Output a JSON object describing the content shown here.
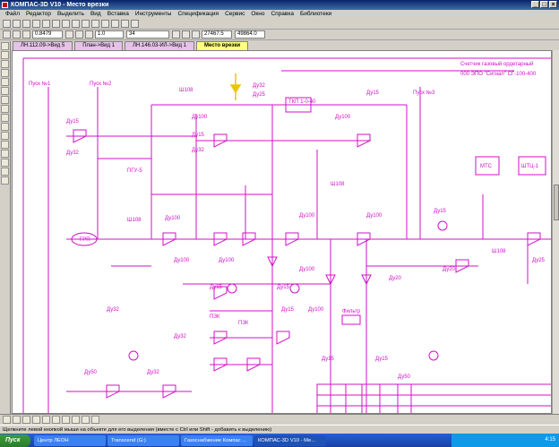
{
  "window": {
    "title": "КОМПАС-3D V10 - Место врезки"
  },
  "menu": [
    "Файл",
    "Редактор",
    "Выделить",
    "Вид",
    "Вставка",
    "Инструменты",
    "Спецификация",
    "Сервис",
    "Окно",
    "Справка",
    "Библиотеки"
  ],
  "toolbar": {
    "zoom": "0.8479",
    "line_width": "1.0",
    "layer": "34",
    "coord_x": "27467.5",
    "coord_y": "49864.0"
  },
  "tabs": [
    {
      "label": "ЛН.112.09->Вид 5",
      "active": false
    },
    {
      "label": "План->Вид 1",
      "active": false
    },
    {
      "label": "ЛН.146.03-ИЛ->Вид 1",
      "active": false
    },
    {
      "label": "Место врезки",
      "active": true
    }
  ],
  "drawing": {
    "stamp_line1": "Счетчик газовый ордетарный",
    "stamp_line2": "000 ЭПО \"Сигнал\" СГ-100-400",
    "labels": [
      "Пуск №1",
      "Пуск №2",
      "Ду15",
      "Ду32",
      "Ду100",
      "Ду15",
      "Ду32",
      "ПГУ-5",
      "Ш108",
      "Ду100",
      "Ду32",
      "Ду25",
      "Ду15",
      "Ду100",
      "Ду100",
      "Ду100",
      "МТС",
      "ШТЦ-1",
      "Ду15",
      "Ш108",
      "Ду100",
      "Ду100",
      "ГРП",
      "Ш108",
      "Ду15",
      "Ду15",
      "Ш108",
      "Ду20",
      "Ду100",
      "Ду50",
      "Ду32",
      "Ду15",
      "ПЗК",
      "ПЗК",
      "Ду100",
      "Фильтр",
      "Ду15",
      "Ду15",
      "Ду20",
      "Ду50",
      "Ду32",
      "Ду32",
      "Пуск №3",
      "ТКП 1-0-40",
      "Ду25"
    ]
  },
  "status": "Щелкните левой кнопкой мыши на объекте для его выделения (вместе с Ctrl или Shift - добавить к выделению)",
  "taskbar": {
    "start": "Пуск",
    "tasks": [
      "Центр ЛЕОН",
      "Transcend (G:)",
      "Газоснабжение Компас ...",
      "КОМПАС-3D V10 - Ме..."
    ],
    "time": "4:15"
  }
}
